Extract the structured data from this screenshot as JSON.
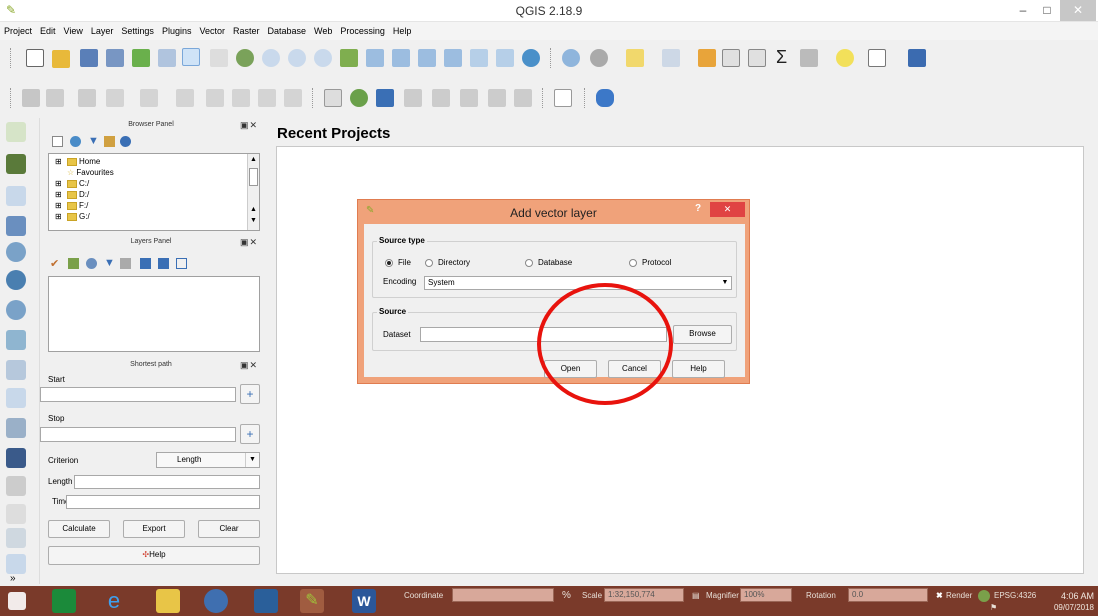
{
  "window": {
    "title": "QGIS 2.18.9",
    "minimize": "–",
    "maximize": "□",
    "close": "✕"
  },
  "menu": [
    "Project",
    "Edit",
    "View",
    "Layer",
    "Settings",
    "Plugins",
    "Vector",
    "Raster",
    "Database",
    "Web",
    "Processing",
    "Help"
  ],
  "browser_panel": {
    "title": "Browser Panel",
    "items": [
      {
        "label": "Home",
        "icon": "folder-icon"
      },
      {
        "label": "Favourites",
        "icon": "star-icon"
      },
      {
        "label": "C:/",
        "icon": "folder-icon"
      },
      {
        "label": "D:/",
        "icon": "folder-icon"
      },
      {
        "label": "F:/",
        "icon": "folder-icon"
      },
      {
        "label": "G:/",
        "icon": "folder-icon"
      }
    ]
  },
  "layers_panel": {
    "title": "Layers Panel"
  },
  "shortest_path": {
    "title": "Shortest path",
    "start_label": "Start",
    "stop_label": "Stop",
    "criterion_label": "Criterion",
    "criterion_value": "Length",
    "length_label": "Length",
    "time_label": "Time",
    "calculate": "Calculate",
    "export": "Export",
    "clear": "Clear",
    "help": "Help"
  },
  "main": {
    "recent_title": "Recent Projects"
  },
  "dialog": {
    "title": "Add vector layer",
    "help_btn": "?",
    "close_btn": "✕",
    "source_type_title": "Source type",
    "radios": [
      "File",
      "Directory",
      "Database",
      "Protocol"
    ],
    "selected_radio": "File",
    "encoding_label": "Encoding",
    "encoding_value": "System",
    "source_title": "Source",
    "dataset_label": "Dataset",
    "dataset_value": "",
    "browse": "Browse",
    "open": "Open",
    "cancel": "Cancel",
    "help": "Help"
  },
  "statusbar": {
    "coordinate_label": "Coordinate",
    "scale_label": "Scale",
    "scale_value": "1:32,150,774",
    "magnifier_label": "Magnifier",
    "magnifier_value": "100%",
    "rotation_label": "Rotation",
    "rotation_value": "0.0",
    "render_label": "Render",
    "crs": "EPSG:4326"
  },
  "clock": {
    "time": "4:06 AM",
    "date": "09/07/2018"
  },
  "colors": {
    "dialog_title_bg": "#f0a27a",
    "annotation": "#e8130d",
    "taskbar": "#7a3a2a"
  }
}
